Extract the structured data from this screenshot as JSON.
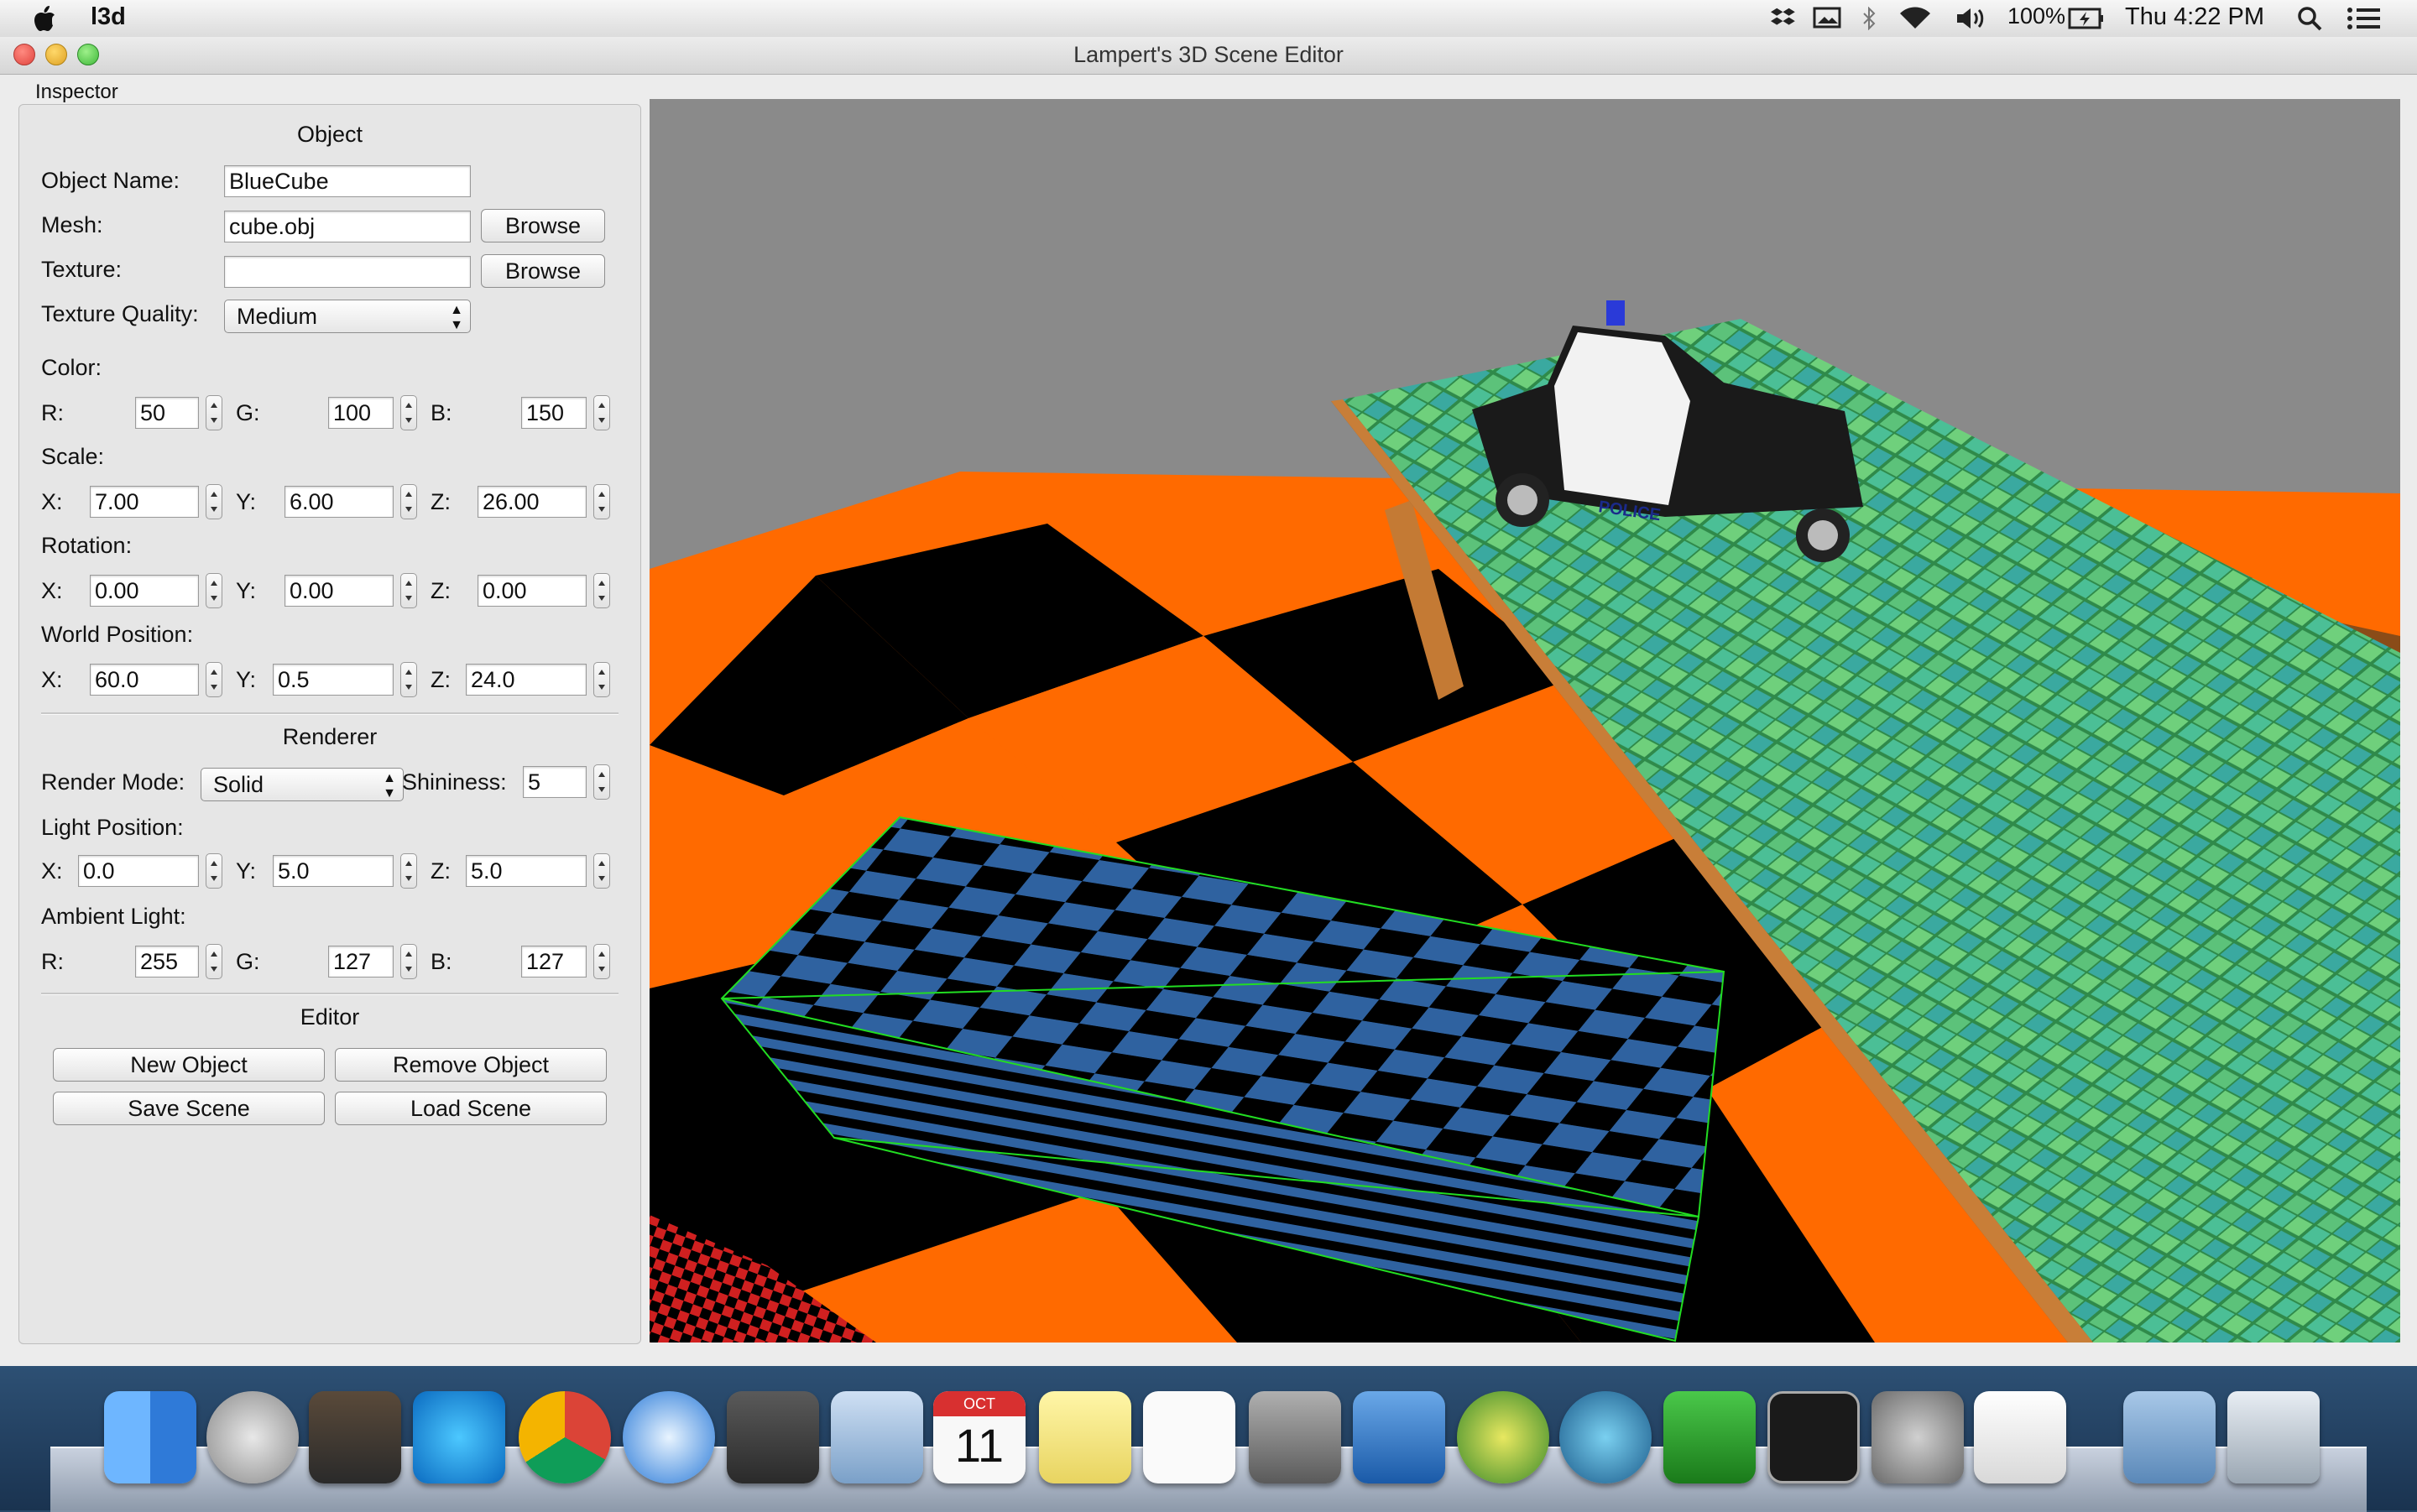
{
  "menubar": {
    "app_name": "l3d",
    "battery": "100%",
    "clock": "Thu 4:22 PM"
  },
  "window": {
    "title": "Lampert's 3D Scene Editor"
  },
  "inspector": {
    "title": "Inspector",
    "object": {
      "header": "Object",
      "name_label": "Object Name:",
      "name_value": "BlueCube",
      "mesh_label": "Mesh:",
      "mesh_value": "cube.obj",
      "texture_label": "Texture:",
      "texture_value": "",
      "browse_label": "Browse",
      "texture_quality_label": "Texture Quality:",
      "texture_quality_value": "Medium",
      "color_label": "Color:",
      "color": {
        "r_label": "R:",
        "r": "50",
        "g_label": "G:",
        "g": "100",
        "b_label": "B:",
        "b": "150"
      },
      "scale_label": "Scale:",
      "scale": {
        "x_label": "X:",
        "x": "7.00",
        "y_label": "Y:",
        "y": "6.00",
        "z_label": "Z:",
        "z": "26.00"
      },
      "rotation_label": "Rotation:",
      "rotation": {
        "x_label": "X:",
        "x": "0.00",
        "y_label": "Y:",
        "y": "0.00",
        "z_label": "Z:",
        "z": "0.00"
      },
      "world_position_label": "World Position:",
      "world_position": {
        "x_label": "X:",
        "x": "60.0",
        "y_label": "Y:",
        "y": "0.5",
        "z_label": "Z:",
        "z": "24.0"
      }
    },
    "renderer": {
      "header": "Renderer",
      "render_mode_label": "Render Mode:",
      "render_mode_value": "Solid",
      "shininess_label": "Shininess:",
      "shininess_value": "5",
      "light_position_label": "Light Position:",
      "light_position": {
        "x_label": "X:",
        "x": "0.0",
        "y_label": "Y:",
        "y": "5.0",
        "z_label": "Z:",
        "z": "5.0"
      },
      "ambient_label": "Ambient Light:",
      "ambient": {
        "r_label": "R:",
        "r": "255",
        "g_label": "G:",
        "g": "127",
        "b_label": "B:",
        "b": "127"
      }
    },
    "editor": {
      "header": "Editor",
      "new_object": "New Object",
      "remove_object": "Remove Object",
      "save_scene": "Save Scene",
      "load_scene": "Load Scene"
    }
  },
  "viewport": {
    "car_text": "POLICE",
    "colors": {
      "floor_orange": "#ff6a00",
      "floor_black": "#000000",
      "cube_blue": "#2f62a0",
      "wireframe": "#22dd22",
      "tile_green": "#3cae6a",
      "wood": "#b86a28",
      "sky": "#8c8c8c"
    }
  },
  "dock": {
    "icons": [
      "finder-icon",
      "launchpad-icon",
      "photo-browser-icon",
      "wallpaper-icon",
      "chrome-icon",
      "safari-icon",
      "steam-icon",
      "mail-icon",
      "calendar-icon",
      "notes-icon",
      "reminders-icon",
      "calculator-icon",
      "xcode-icon",
      "app-icon",
      "sourcetree-icon",
      "vim-icon",
      "terminal-icon",
      "system-preferences-icon",
      "textedit-icon",
      "downloads-folder-icon",
      "trash-icon"
    ],
    "calendar_month": "OCT",
    "calendar_day": "11"
  }
}
